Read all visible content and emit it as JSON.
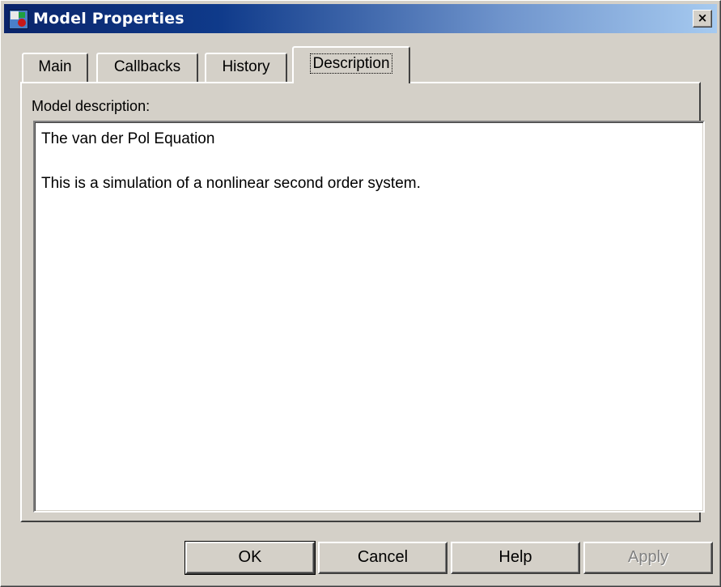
{
  "window": {
    "title": "Model Properties",
    "close_glyph": "×",
    "icon": "simulink-model-icon"
  },
  "tabs": [
    {
      "label": "Main",
      "active": false
    },
    {
      "label": "Callbacks",
      "active": false
    },
    {
      "label": "History",
      "active": false
    },
    {
      "label": "Description",
      "active": true
    }
  ],
  "description_panel": {
    "label": "Model description:",
    "text_lines": [
      "The van der Pol Equation",
      "This is a simulation of a nonlinear second order system."
    ]
  },
  "buttons": {
    "ok": "OK",
    "cancel": "Cancel",
    "help": "Help",
    "apply": "Apply",
    "apply_enabled": false
  },
  "colors": {
    "face": "#d4d0c8",
    "title_gradient_start": "#0a246a",
    "title_gradient_end": "#a6caf0",
    "title_text": "#ffffff"
  }
}
